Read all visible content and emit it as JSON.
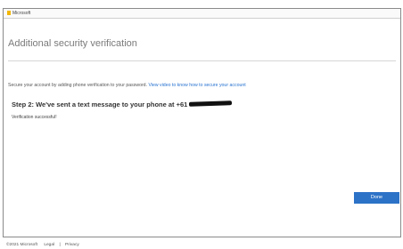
{
  "brand": {
    "name": "Microsoft",
    "logo_color": "#f2b705"
  },
  "page": {
    "title": "Additional security verification",
    "intro_text": "Secure your account by adding phone verification to your password.",
    "intro_link": "View video to know how to secure your account",
    "step_heading": "Step 2: We've sent a text message to your phone at +61",
    "status_message": "Verification successful!"
  },
  "actions": {
    "done_label": "Done",
    "accent_color": "#2c72c7"
  },
  "footer": {
    "copyright": "©2021 Microsoft",
    "legal": "Legal",
    "separator": "|",
    "privacy": "Privacy"
  }
}
